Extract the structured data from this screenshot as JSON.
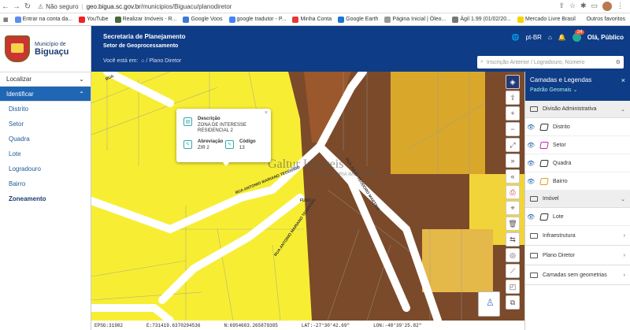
{
  "browser": {
    "security": "Não seguro",
    "url_host": "geo.bigua.sc.gov.br",
    "url_path": "/municipios/Biguacu/planodiretor"
  },
  "bookmarks": [
    {
      "label": "Entrar na conta da...",
      "color": "#5b8ef0"
    },
    {
      "label": "YouTube",
      "color": "#e22"
    },
    {
      "label": "Realizar Imóveis - R...",
      "color": "#4a6a3a"
    },
    {
      "label": "Google Voos",
      "color": "#3a7bd5"
    },
    {
      "label": "google tradutor - P...",
      "color": "#4285f4"
    },
    {
      "label": "Minha Conta",
      "color": "#e53935"
    },
    {
      "label": "Google Earth",
      "color": "#1976d2"
    },
    {
      "label": "Página Inicial | Óleo...",
      "color": "#999"
    },
    {
      "label": "Ágil 1.99 (01/02/20...",
      "color": "#777"
    },
    {
      "label": "Mercado Livre Brasil",
      "color": "#f7d400"
    }
  ],
  "other_bookmarks": "Outros favoritos",
  "municipality": {
    "prefix": "Município de",
    "name": "Biguaçu"
  },
  "sidebar": {
    "localizar": "Localizar",
    "identificar": "Identificar",
    "items": [
      "Distrito",
      "Setor",
      "Quadra",
      "Lote",
      "Logradouro",
      "Bairro",
      "Zoneamento"
    ]
  },
  "header": {
    "title": "Secretaria de Planejamento",
    "subtitle": "Setor de Geoprocessamento",
    "crumb_label": "Você está em:",
    "crumb_page": "Plano Diretor",
    "lang": "pt-BR",
    "notifications": "24",
    "user": "Olá, Público"
  },
  "search": {
    "placeholder": "Inscrição Anterior / Logradouro, Número"
  },
  "popup": {
    "desc_label": "Descrição",
    "desc_value_1": "ZONA DE INTERESSE",
    "desc_value_2": "RESIDENCIAL 2",
    "abbr_label": "Abreviação",
    "abbr_value": "ZIR 2",
    "code_label": "Código",
    "code_value": "13"
  },
  "map_labels": {
    "street1": "RUA ANTONIO MARIANO TEODOSIO",
    "street2": "RUA JULIO TEODORO MARTINS",
    "street3": "RUA ANTONIO MARIANO TEODÓSIO",
    "fund": "FUND",
    "street4": "RUA"
  },
  "watermark": {
    "main": "Galtur Imóveis",
    "sub": "CONSULTORIA IMOBILIÁRIA"
  },
  "status": {
    "epsg": "EPSG:31982",
    "e": "E:731419.6370294536",
    "n": "N:6954683.265879385",
    "lat": "LAT:-27°30'42.69\"",
    "lon": "LON:-48°39'25.82\""
  },
  "panel": {
    "title": "Camadas e Legendas",
    "mode": "Padrão Geomais",
    "div_admin": "Divisão Administrativa",
    "admin_layers": [
      {
        "label": "Distrito",
        "color": "#333"
      },
      {
        "label": "Setor",
        "color": "#c026c0"
      },
      {
        "label": "Quadra",
        "color": "#333"
      },
      {
        "label": "Bairro",
        "color": "#e69d1f"
      }
    ],
    "imovel": "Imóvel",
    "imovel_layers": [
      {
        "label": "Lote",
        "color": "#333"
      }
    ],
    "groups": [
      "Infraestrutura",
      "Plano Diretor",
      "Camadas sem geometrias"
    ]
  }
}
